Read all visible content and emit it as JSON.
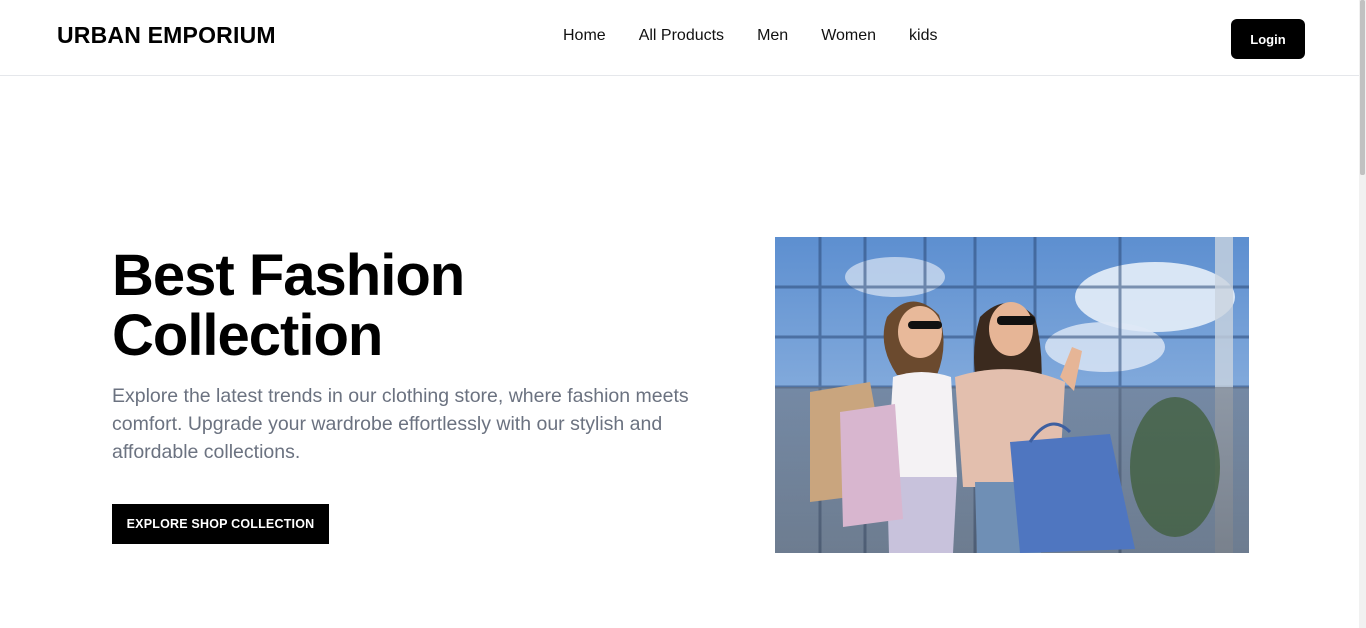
{
  "header": {
    "brand": "URBAN EMPORIUM",
    "nav": [
      "Home",
      "All Products",
      "Men",
      "Women",
      "kids"
    ],
    "login_label": "Login"
  },
  "hero": {
    "title_line1": "Best Fashion",
    "title_line2": "Collection",
    "description": "Explore the latest trends in our clothing store, where fashion meets comfort. Upgrade your wardrobe effortlessly with our stylish and affordable collections.",
    "cta_label": "EXPLORE SHOP COLLECTION"
  },
  "colors": {
    "primary": "#000000",
    "text_muted": "#6b7280",
    "border": "#e5e7eb"
  }
}
